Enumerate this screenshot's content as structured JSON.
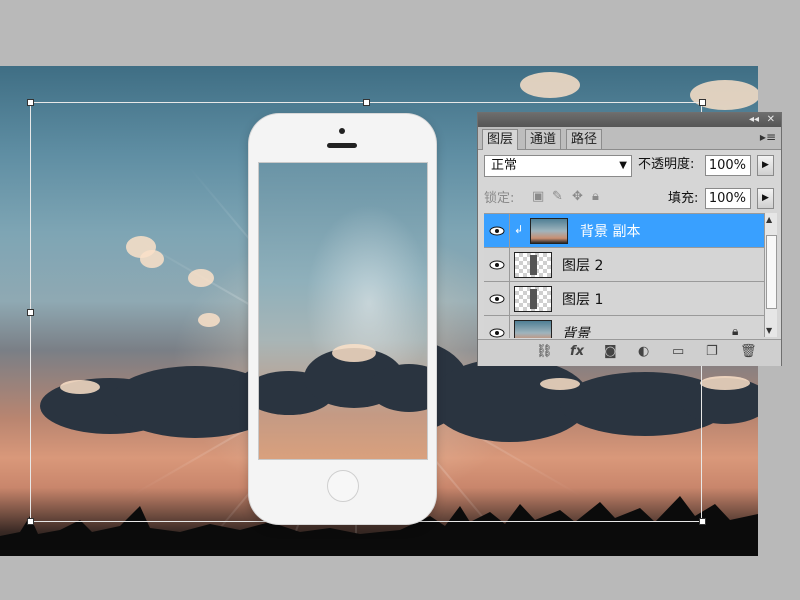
{
  "canvas": {
    "description_icons": [
      "crosshair-icon"
    ]
  },
  "layers_panel": {
    "tabs": [
      "图层",
      "通道",
      "路径"
    ],
    "active_tab": 0,
    "blend_mode": "正常",
    "opacity_label": "不透明度:",
    "opacity_value": "100%",
    "lock_label": "锁定:",
    "fill_label": "填充:",
    "fill_value": "100%",
    "layers": [
      {
        "name": "背景 副本",
        "thumbnail": "photo",
        "selected": true,
        "clipped": true
      },
      {
        "name": "图层 2",
        "thumbnail": "transparent-phone",
        "selected": false
      },
      {
        "name": "图层 1",
        "thumbnail": "transparent-phone",
        "selected": false
      },
      {
        "name": "背景",
        "thumbnail": "photo",
        "selected": false,
        "locked": true
      }
    ],
    "bottom_icons": [
      "link-icon",
      "fx-icon",
      "mask-icon",
      "adjustment-icon",
      "group-folder-icon",
      "new-layer-icon",
      "trash-icon"
    ],
    "colors": {
      "selected_row": "#39a0ff",
      "panel_bg": "#d6d6d6"
    }
  }
}
